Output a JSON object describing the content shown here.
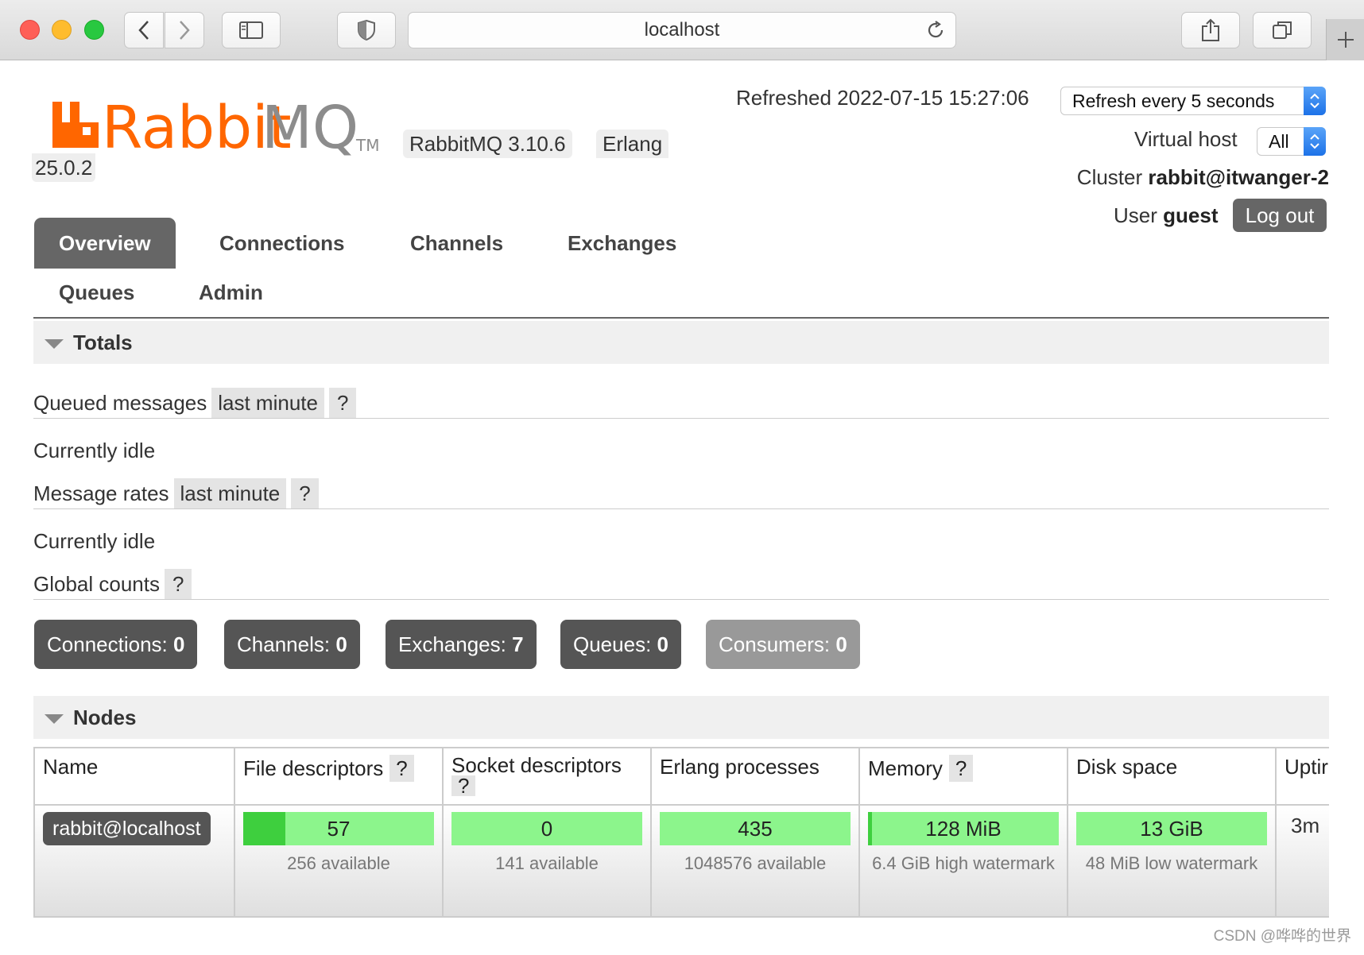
{
  "browser": {
    "url": "localhost"
  },
  "header": {
    "rabbitmq_version": "RabbitMQ 3.10.6",
    "erlang_label": "Erlang",
    "erlang_version": "25.0.2",
    "refreshed": "Refreshed 2022-07-15 15:27:06",
    "refresh_select": "Refresh every 5 seconds",
    "vhost_label": "Virtual host",
    "vhost_select": "All",
    "cluster_label": "Cluster",
    "cluster_name": "rabbit@itwanger-2",
    "user_label": "User",
    "user_name": "guest",
    "logout_label": "Log out"
  },
  "tabs": [
    "Overview",
    "Connections",
    "Channels",
    "Exchanges",
    "Queues",
    "Admin"
  ],
  "totals": {
    "title": "Totals",
    "queued_label": "Queued messages",
    "queued_range": "last minute",
    "help": "?",
    "queued_idle": "Currently idle",
    "rates_label": "Message rates",
    "rates_range": "last minute",
    "rates_idle": "Currently idle",
    "global_label": "Global counts"
  },
  "counts": [
    {
      "label": "Connections:",
      "value": "0"
    },
    {
      "label": "Channels:",
      "value": "0"
    },
    {
      "label": "Exchanges:",
      "value": "7"
    },
    {
      "label": "Queues:",
      "value": "0"
    },
    {
      "label": "Consumers:",
      "value": "0"
    }
  ],
  "nodes": {
    "title": "Nodes",
    "headers": [
      "Name",
      "File descriptors",
      "Socket descriptors",
      "Erlang processes",
      "Memory",
      "Disk space",
      "Uptir"
    ],
    "help": "?",
    "row": {
      "name": "rabbit@localhost",
      "file_descriptors": "57",
      "file_descriptors_sub": "256 available",
      "file_descriptors_fraction": 0.22,
      "socket_descriptors": "0",
      "socket_descriptors_sub": "141 available",
      "erlang_processes": "435",
      "erlang_processes_sub": "1048576 available",
      "memory": "128 MiB",
      "memory_sub": "6.4 GiB high watermark",
      "memory_fraction": 0.02,
      "disk": "13 GiB",
      "disk_sub": "48 MiB low watermark",
      "uptime": "3m"
    }
  },
  "watermark": "CSDN @哗哗的世界",
  "colors": {
    "brand_orange": "#ff6600",
    "tab_active": "#666666",
    "bar_green": "#8cf58c",
    "bar_fill": "#3ecf3e"
  }
}
